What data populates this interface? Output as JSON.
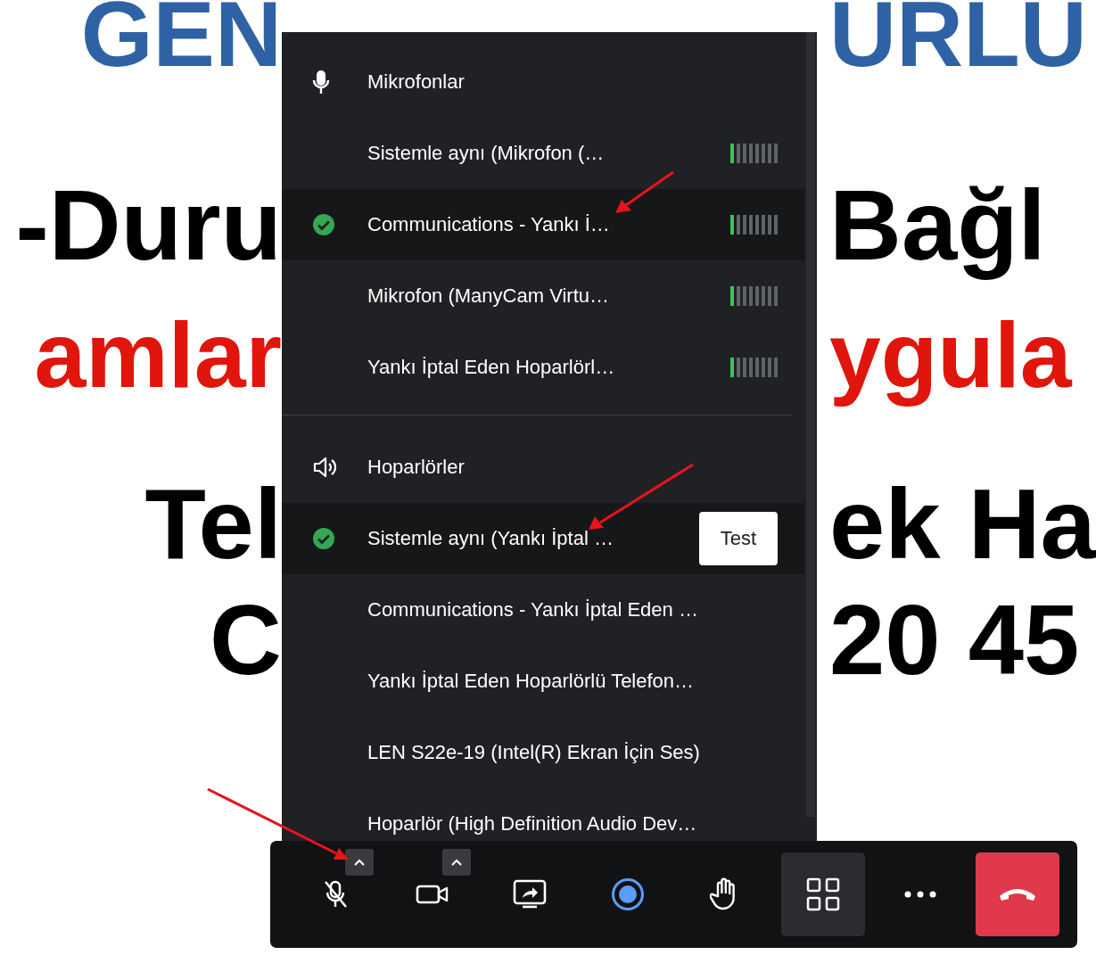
{
  "slide": {
    "lines": [
      {
        "left": "GEN",
        "right": "URLU",
        "color": "#2f62a4"
      },
      {
        "left": "-Duru",
        "right": "Bağl",
        "color": "#000000"
      },
      {
        "left": "amlar",
        "right": "ygula",
        "color": "#e0150b"
      },
      {
        "left": "Tel",
        "right": "ek Ha",
        "color": "#000000"
      },
      {
        "left": "C",
        "right": "20 45",
        "color": "#000000"
      }
    ]
  },
  "device_menu": {
    "sections": [
      {
        "kind": "microphones",
        "title": "Mikrofonlar",
        "devices": [
          {
            "name": "Sistemle aynı (Mikrofon (…",
            "selected": false,
            "level": 0.125
          },
          {
            "name": "Communications - Yankı İ…",
            "selected": true,
            "level": 0.125
          },
          {
            "name": "Mikrofon (ManyCam Virtu…",
            "selected": false,
            "level": 0.125
          },
          {
            "name": "Yankı İptal Eden Hoparlörl…",
            "selected": false,
            "level": 0.125
          }
        ]
      },
      {
        "kind": "speakers",
        "title": "Hoparlörler",
        "devices": [
          {
            "name": "Sistemle aynı (Yankı İptal …",
            "selected": true,
            "button": "Test"
          },
          {
            "name": "Communications - Yankı İptal Eden …",
            "selected": false
          },
          {
            "name": "Yankı İptal Eden Hoparlörlü Telefon…",
            "selected": false
          },
          {
            "name": "LEN S22e-19 (Intel(R) Ekran İçin Ses)",
            "selected": false
          },
          {
            "name": "Hoparlör (High Definition Audio Dev…",
            "selected": false
          }
        ]
      }
    ]
  },
  "toolbar": {
    "buttons": [
      {
        "kind": "mic_off",
        "has_menu": true,
        "active": false
      },
      {
        "kind": "camera",
        "has_menu": true,
        "active": false
      },
      {
        "kind": "share",
        "has_menu": false,
        "active": false
      },
      {
        "kind": "record",
        "has_menu": false,
        "active": false
      },
      {
        "kind": "raise_hand",
        "has_menu": false,
        "active": false
      },
      {
        "kind": "layout",
        "has_menu": false,
        "active": true
      },
      {
        "kind": "more",
        "has_menu": false,
        "active": false
      },
      {
        "kind": "hang_up",
        "has_menu": false,
        "active": false
      }
    ]
  }
}
